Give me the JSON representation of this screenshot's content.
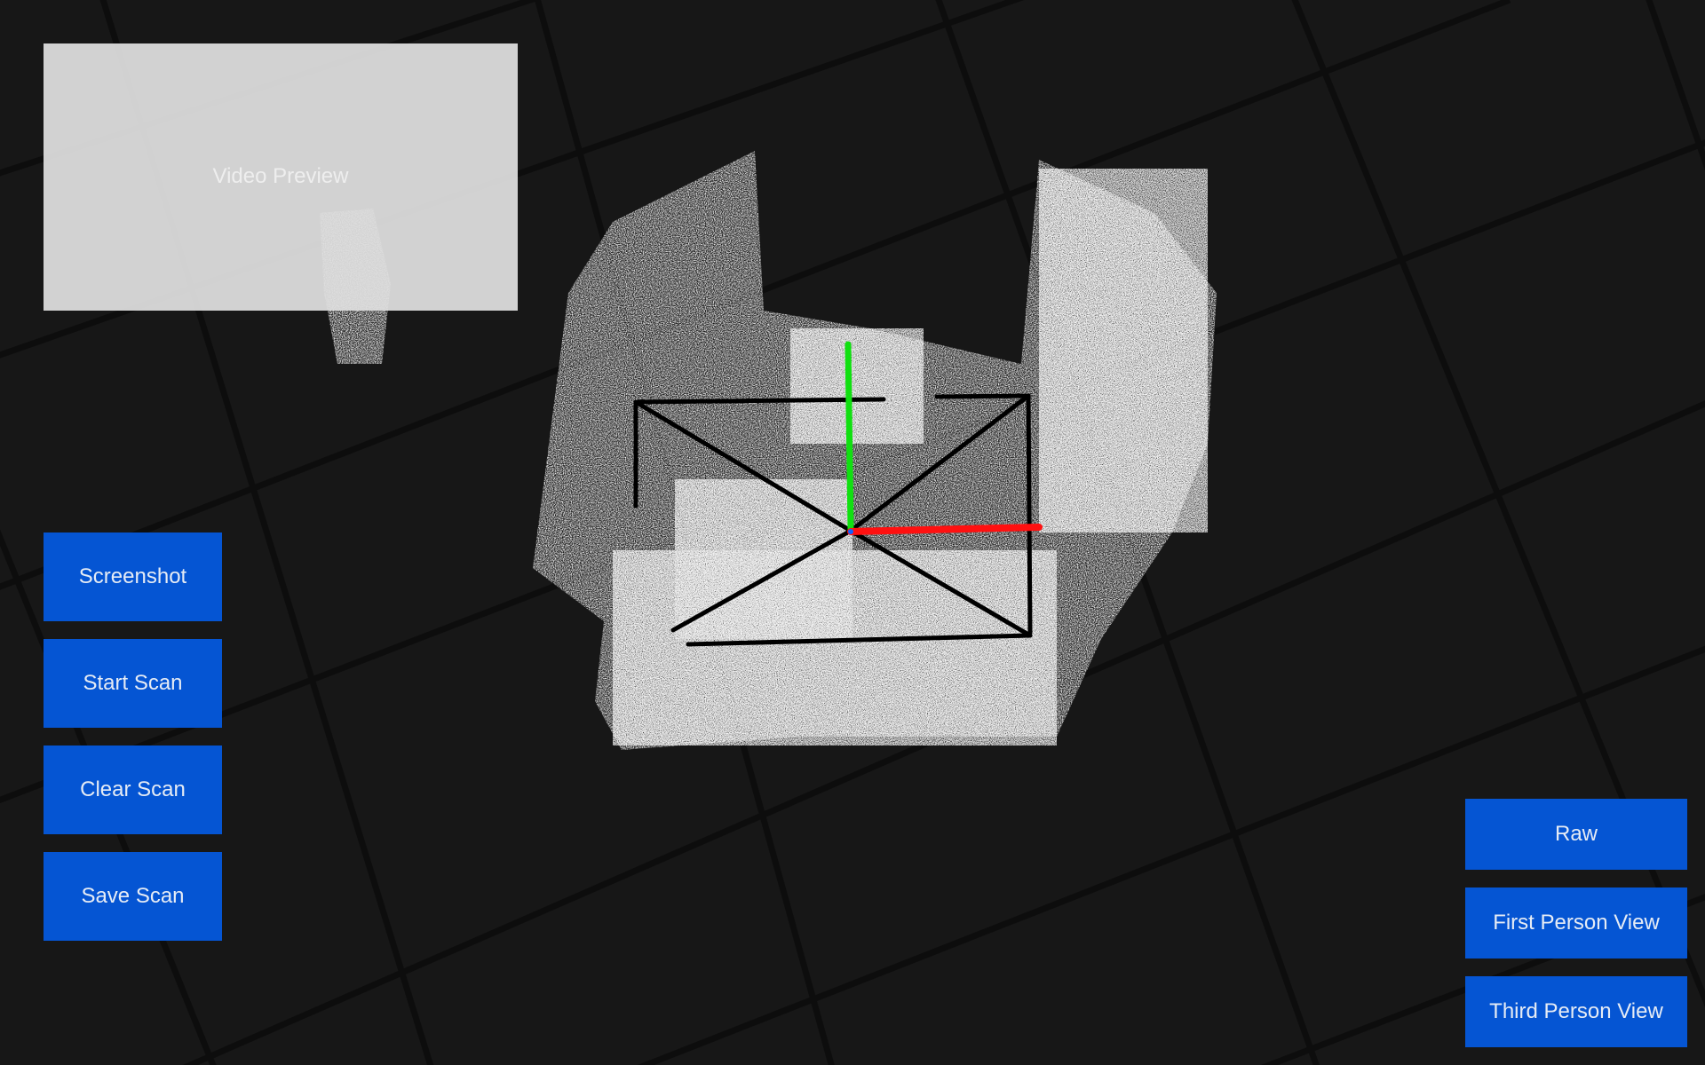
{
  "preview": {
    "label": "Video Preview"
  },
  "controls": {
    "screenshot_label": "Screenshot",
    "start_scan_label": "Start Scan",
    "clear_scan_label": "Clear Scan",
    "save_scan_label": "Save Scan"
  },
  "views": {
    "raw_label": "Raw",
    "first_person_label": "First Person View",
    "third_person_label": "Third Person View"
  },
  "colors": {
    "background": "#171717",
    "grid_line": "#0c0c0c",
    "button": "#0555d3",
    "button_text": "#e6ecf5",
    "preview_panel": "#dedede",
    "point_cloud": "#ffffff",
    "axis_x": "#ff1010",
    "axis_y": "#10e010",
    "frustum": "#000000"
  },
  "icons": {
    "axis_gizmo": "xyz-axis-icon",
    "camera": "camera-frustum-icon"
  }
}
